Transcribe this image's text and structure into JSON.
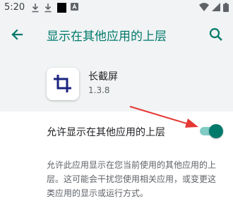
{
  "status_bar": {
    "time": "5:20"
  },
  "app_bar": {
    "title": "显示在其他应用的上层"
  },
  "app": {
    "name": "长截屏",
    "version": "1.3.8"
  },
  "setting": {
    "label": "允许显示在其他应用的上层",
    "enabled": true
  },
  "description": "允许此应用显示在您当前使用的其他应用的上层。这可能会干扰您使用相关应用，或变更这类应用的显示或运行方式。",
  "colors": {
    "accent": "#00796b",
    "annotation_arrow": "#e53935"
  }
}
